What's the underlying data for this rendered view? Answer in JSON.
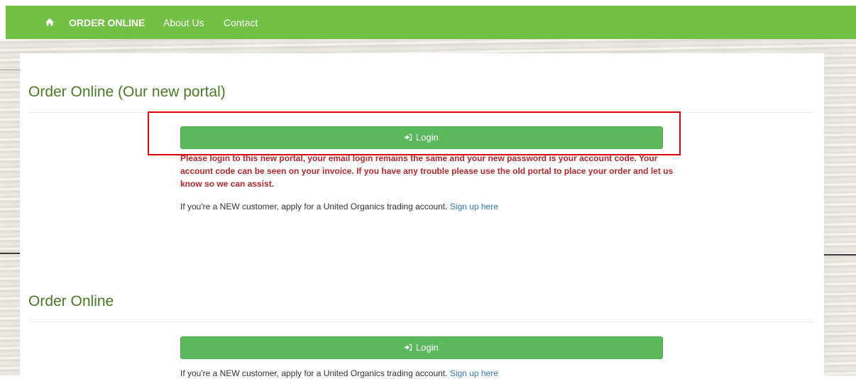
{
  "nav": {
    "home_icon": "home-icon",
    "items": [
      {
        "label": "ORDER ONLINE",
        "active": true
      },
      {
        "label": "About Us"
      },
      {
        "label": "Contact"
      }
    ],
    "color": "#72c045"
  },
  "sections": [
    {
      "heading": "Order Online (Our new portal)",
      "login_label": "Login",
      "notice": "Please login to this new portal, your email login remains the same and your new password is your account code. Your account code can be seen on your invoice. If you have any trouble please use the old portal to place your order and let us know so we can assist.",
      "signup_text": "If you're a NEW customer, apply for a United Organics trading account.",
      "signup_link": "Sign up here"
    },
    {
      "heading": "Order Online",
      "login_label": "Login",
      "signup_text": "If you're a NEW customer, apply for a United Organics trading account.",
      "signup_link": "Sign up here"
    }
  ],
  "colors": {
    "heading": "#4a7a26",
    "button": "#5cb85c",
    "notice": "#b1282d",
    "link": "#337ab7",
    "highlight": "#e0000b"
  }
}
